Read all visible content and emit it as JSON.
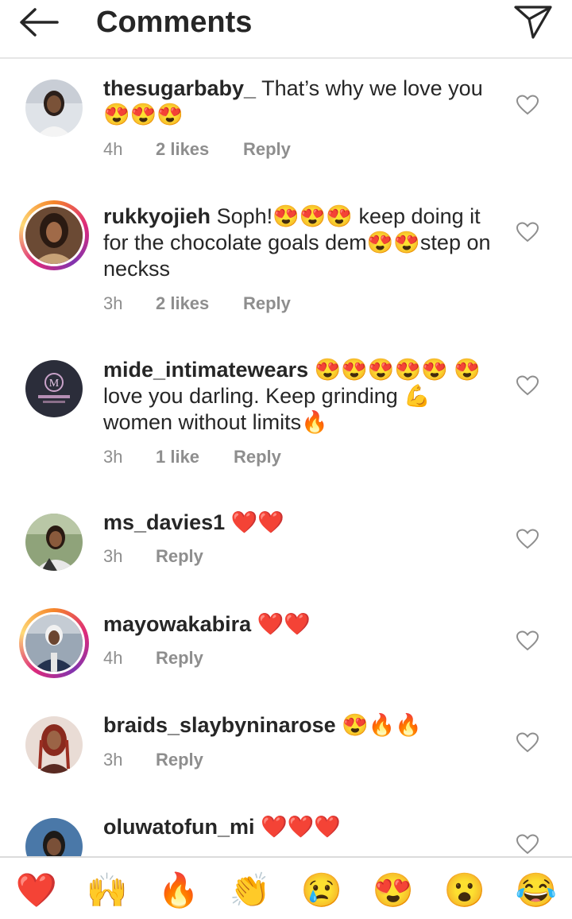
{
  "header": {
    "title": "Comments"
  },
  "comments": [
    {
      "username": "thesugarbaby_",
      "text": "That’s why we love you 😍😍😍",
      "time": "4h",
      "likes": "2 likes",
      "reply": "Reply"
    },
    {
      "username": "rukkyojieh",
      "text": "Soph!😍😍😍 keep doing it for the chocolate goals dem😍😍step on neckss",
      "time": "3h",
      "likes": "2 likes",
      "reply": "Reply"
    },
    {
      "username": "mide_intimatewears",
      "text": "😍😍😍😍😍 😍 love you darling. Keep grinding 💪 women without limits🔥",
      "time": "3h",
      "likes": "1 like",
      "reply": "Reply"
    },
    {
      "username": "ms_davies1",
      "text": "❤️❤️",
      "time": "3h",
      "reply": "Reply"
    },
    {
      "username": "mayowakabira",
      "text": "❤️❤️",
      "time": "4h",
      "reply": "Reply"
    },
    {
      "username": "braids_slaybyninarose",
      "text": "😍🔥🔥",
      "time": "3h",
      "reply": "Reply"
    },
    {
      "username": "oluwatofun_mi",
      "text": "❤️❤️❤️"
    }
  ],
  "reactions": [
    "❤️",
    "🙌",
    "🔥",
    "👏",
    "😢",
    "😍",
    "😮",
    "😂"
  ],
  "icons": {
    "back": "back-arrow-icon",
    "send": "send-icon",
    "like": "heart-outline-icon"
  },
  "colors": {
    "text": "#262626",
    "meta": "#8e8e8e",
    "divider": "#dbdbdb"
  }
}
